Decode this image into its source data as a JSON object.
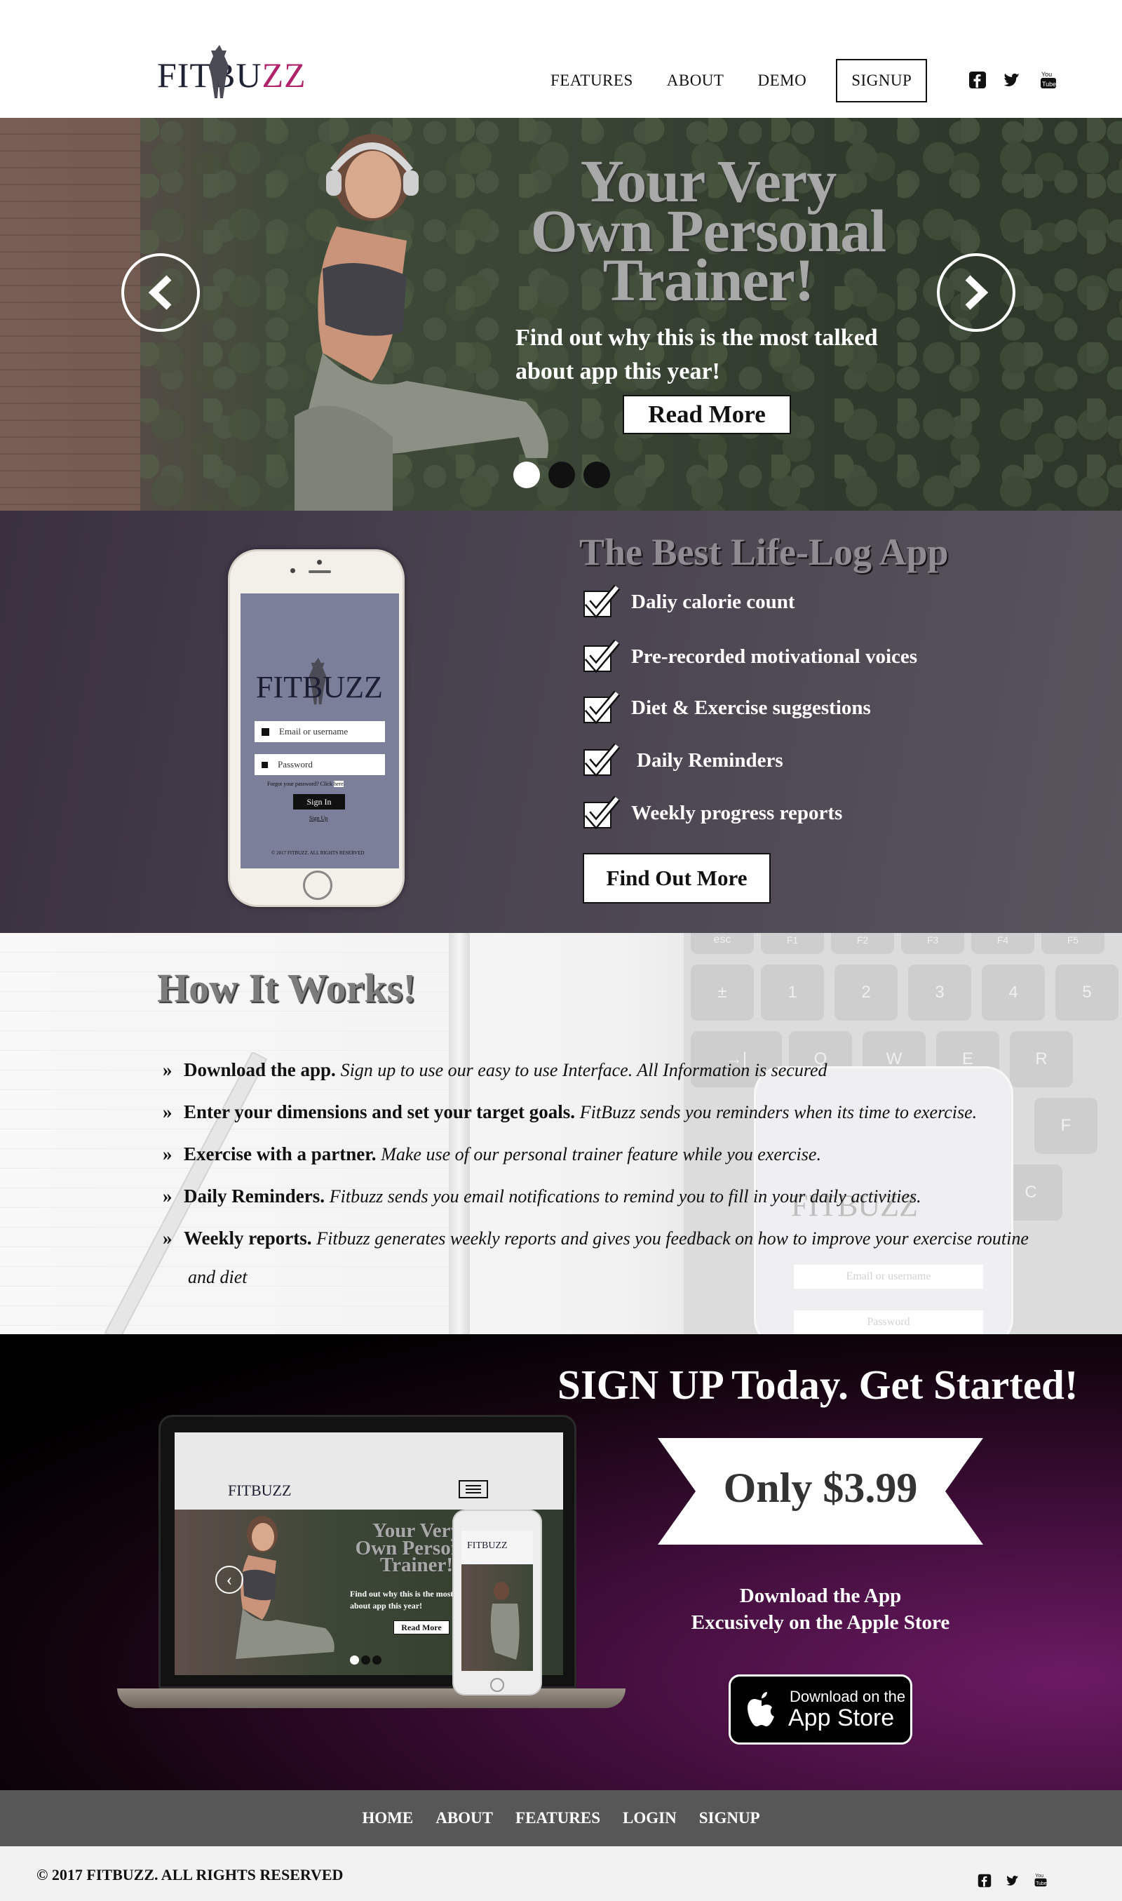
{
  "header": {
    "logo_text_a": "FITB",
    "logo_text_b": "U",
    "logo_text_c": "ZZ",
    "nav": [
      "FEATURES",
      "ABOUT",
      "DEMO"
    ],
    "signup_label": "SIGNUP",
    "social_icons": [
      "facebook-icon",
      "twitter-icon",
      "youtube-icon"
    ]
  },
  "hero": {
    "title_line1": "Your Very",
    "title_line2": "Own Personal",
    "title_line3": "Trainer!",
    "subtitle_line1": "Find out why this is the most talked",
    "subtitle_line2": "about app this year!",
    "button_label": "Read More",
    "active_slide": 1,
    "slide_count": 3
  },
  "features": {
    "title": "The Best Life-Log App",
    "items": [
      "Daliy calorie count",
      "Pre-recorded motivational voices",
      "Diet & Exercise suggestions",
      "Daily Reminders",
      "Weekly progress reports"
    ],
    "button_label": "Find Out More",
    "phone": {
      "logo": "FITBUZZ",
      "email_placeholder": "Email or username",
      "password_placeholder": "Password",
      "forgot_text": "Forgot your password? Click",
      "forgot_link": "here",
      "signin_label": "Sign In",
      "signup_link": "Sign Up",
      "copyright": "© 2017 FITBUZZ. ALL RIGHTS RESERVED"
    }
  },
  "how": {
    "title": "How It Works!",
    "steps": [
      {
        "lead": "Download the app.",
        "text": "Sign up to use our easy to use Interface. All Information is secured"
      },
      {
        "lead": "Enter your dimensions and set your target goals.",
        "text": "FitBuzz sends you reminders when its time to exercise."
      },
      {
        "lead": "Exercise with a partner.",
        "text": "Make use of our personal trainer feature while you exercise."
      },
      {
        "lead": "Daily Reminders.",
        "text": "Fitbuzz sends you email notifications to remind you to fill in your daily activities."
      },
      {
        "lead": "Weekly reports.",
        "text": "Fitbuzz generates weekly reports and gives you feedback on how to improve your exercise routine"
      }
    ],
    "step5_continued": "and diet",
    "bg_phone_email": "Email or username",
    "bg_phone_password": "Password",
    "bg_phone_logo": "FITBUZZ",
    "keyboard_keys": [
      "esc",
      "F1",
      "F2",
      "F3",
      "F4",
      "F5",
      "±",
      "§",
      "!",
      "1",
      "@",
      "€",
      "2",
      "£",
      "#",
      "3",
      "$",
      "4",
      "%",
      "5",
      "Q",
      "W",
      "E",
      "R",
      "F",
      "C"
    ]
  },
  "signup": {
    "title": "SIGN UP Today. Get Started!",
    "price": "Only $3.99",
    "download_line1": "Download the App",
    "download_line2": "Excusively on the Apple Store",
    "appstore_top": "Download on the",
    "appstore_main": "App Store",
    "laptop": {
      "logo": "FITBUZZ",
      "hero_title_1": "Your Very",
      "hero_title_2": "Own Personal",
      "hero_title_3": "Trainer!",
      "hero_sub_1": "Find out why this is the most talked",
      "hero_sub_2": "about app this year!",
      "button": "Read More"
    }
  },
  "footer": {
    "links": [
      "HOME",
      "ABOUT",
      "FEATURES",
      "LOGIN",
      "SIGNUP"
    ],
    "copyright": "© 2017 FITBUZZ. ALL RIGHTS RESERVED"
  },
  "colors": {
    "accent_pink": "#b0236b",
    "features_bg": "#4a4350",
    "footer_nav_bg": "#575757",
    "signup_purple": "#6b1a63"
  }
}
